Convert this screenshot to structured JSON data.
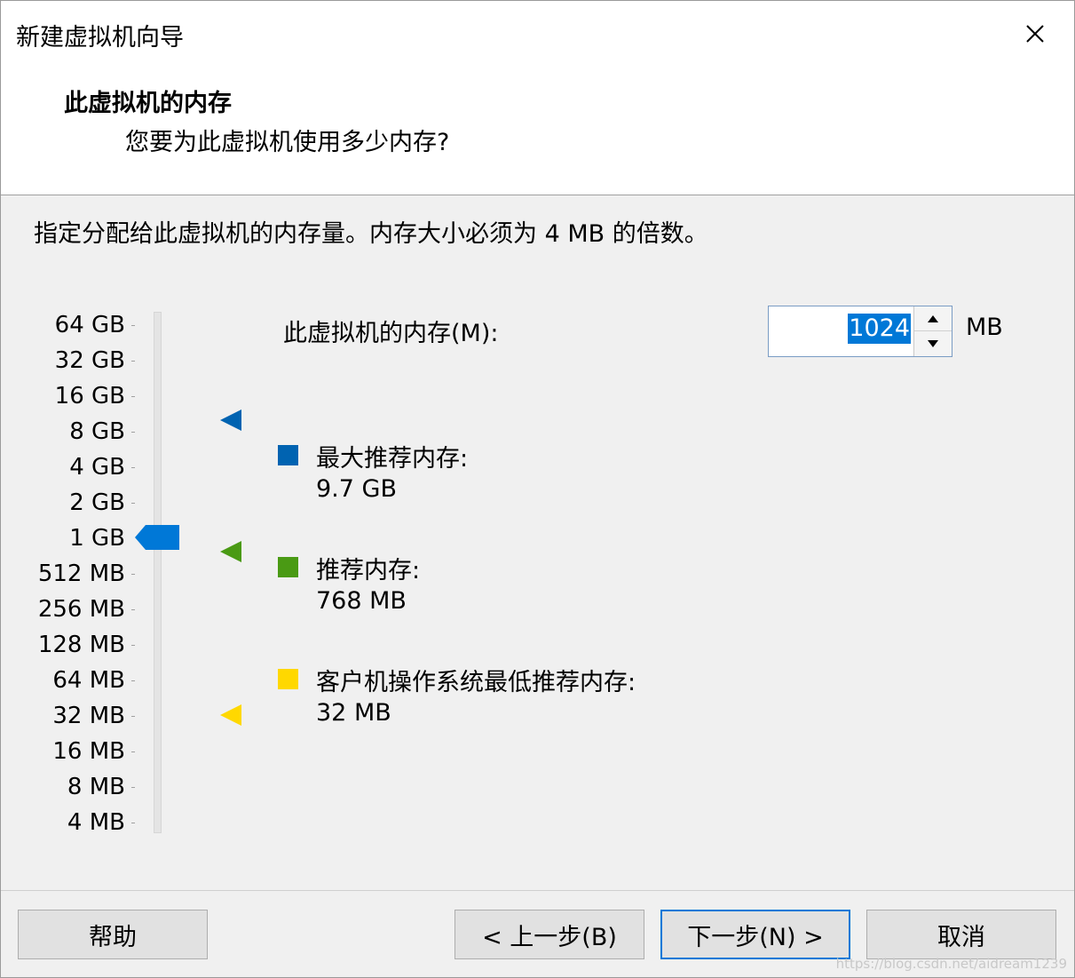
{
  "window": {
    "title": "新建虚拟机向导"
  },
  "header": {
    "title": "此虚拟机的内存",
    "subtitle": "您要为此虚拟机使用多少内存?"
  },
  "instruction": "指定分配给此虚拟机的内存量。内存大小必须为 4 MB 的倍数。",
  "scale": {
    "labels": [
      "64 GB",
      "32 GB",
      "16 GB",
      "8 GB",
      "4 GB",
      "2 GB",
      "1 GB",
      "512 MB",
      "256 MB",
      "128 MB",
      "64 MB",
      "32 MB",
      "16 MB",
      "8 MB",
      "4 MB"
    ],
    "thumb_color": "#0078d7"
  },
  "memory": {
    "label": "此虚拟机的内存(M):",
    "value": "1024",
    "unit": "MB"
  },
  "legend": {
    "max": {
      "label": "最大推荐内存:",
      "value": "9.7 GB",
      "color": "#0063b1"
    },
    "recommended": {
      "label": "推荐内存:",
      "value": "768 MB",
      "color": "#4a9a14"
    },
    "guest_min": {
      "label": "客户机操作系统最低推荐内存:",
      "value": "32 MB",
      "color": "#ffd800"
    }
  },
  "buttons": {
    "help": "帮助",
    "back": "< 上一步(B)",
    "next": "下一步(N) >",
    "cancel": "取消"
  },
  "watermark": "https://blog.csdn.net/aidream1239"
}
